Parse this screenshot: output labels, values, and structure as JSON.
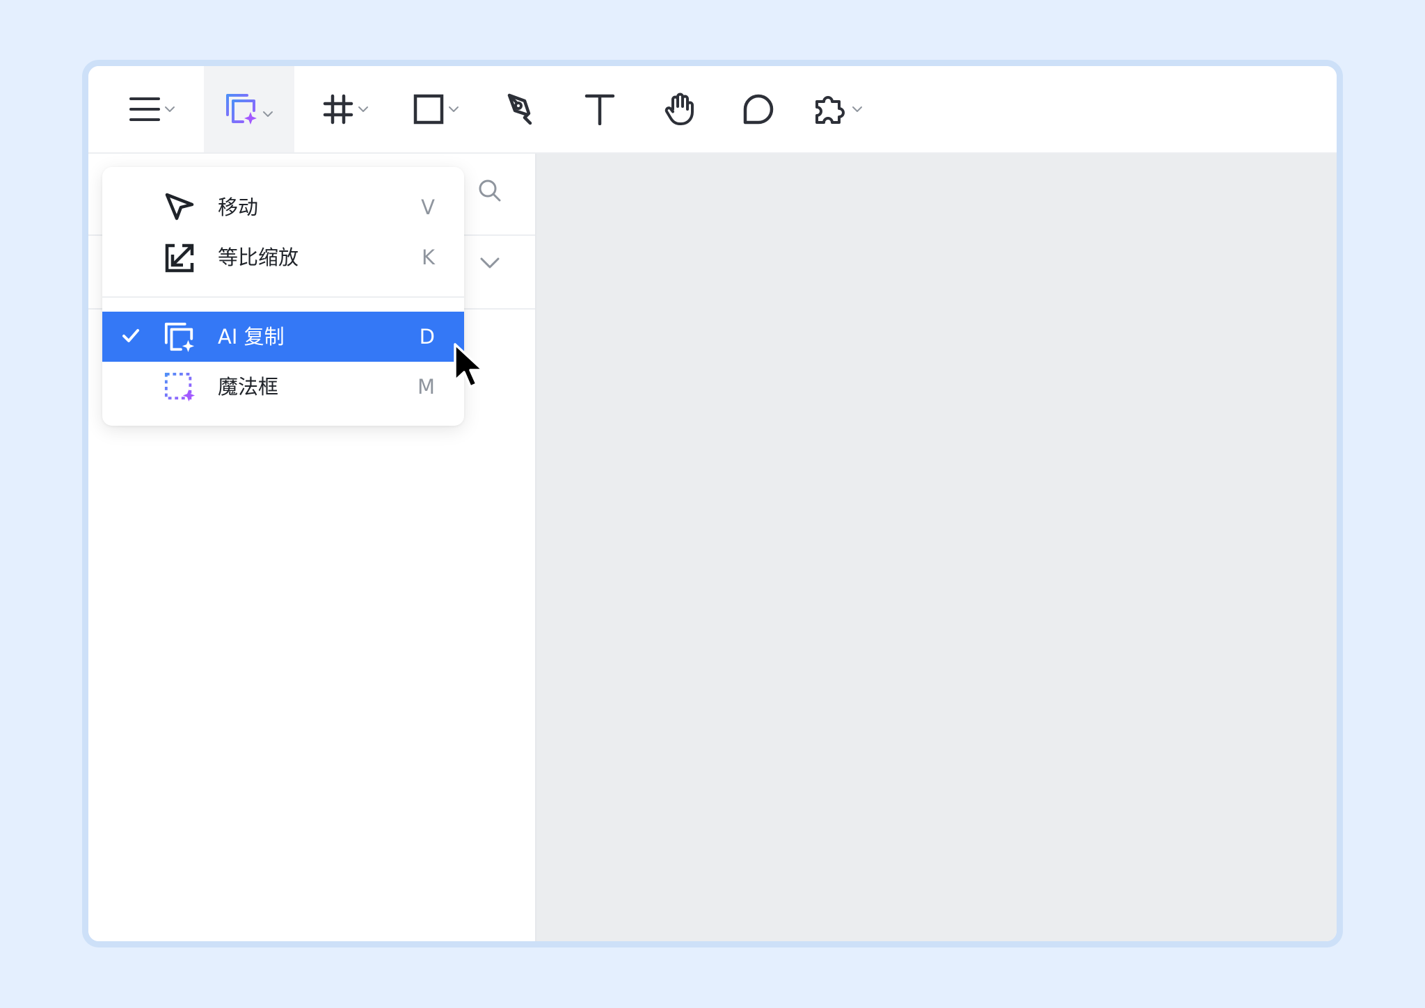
{
  "toolbar": {
    "tools": [
      {
        "id": "main-menu",
        "icon": "hamburger-menu-icon",
        "has_dropdown": true
      },
      {
        "id": "ai-copy",
        "icon": "ai-copy-icon",
        "has_dropdown": true,
        "active": true
      },
      {
        "id": "frame",
        "icon": "frame-hash-icon",
        "has_dropdown": true
      },
      {
        "id": "rectangle",
        "icon": "rectangle-icon",
        "has_dropdown": true
      },
      {
        "id": "pen",
        "icon": "pen-tool-icon",
        "has_dropdown": false
      },
      {
        "id": "text",
        "icon": "text-tool-icon",
        "has_dropdown": false
      },
      {
        "id": "hand",
        "icon": "hand-tool-icon",
        "has_dropdown": false
      },
      {
        "id": "comment",
        "icon": "comment-icon",
        "has_dropdown": false
      },
      {
        "id": "plugins",
        "icon": "plugin-puzzle-icon",
        "has_dropdown": true
      }
    ]
  },
  "tool_menu": {
    "items": [
      {
        "label": "移动",
        "shortcut": "V",
        "icon": "move-cursor-icon",
        "checked": false
      },
      {
        "label": "等比缩放",
        "shortcut": "K",
        "icon": "scale-icon",
        "checked": false
      },
      {
        "label": "AI 复制",
        "shortcut": "D",
        "icon": "ai-copy-icon",
        "checked": true
      },
      {
        "label": "魔法框",
        "shortcut": "M",
        "icon": "magic-frame-icon",
        "checked": false
      }
    ]
  },
  "colors": {
    "accent": "#3478f6",
    "ai_gradient_start": "#4f8ef7",
    "ai_gradient_end": "#a259ff",
    "page_background": "#e4effe",
    "canvas": "#ebedef"
  }
}
